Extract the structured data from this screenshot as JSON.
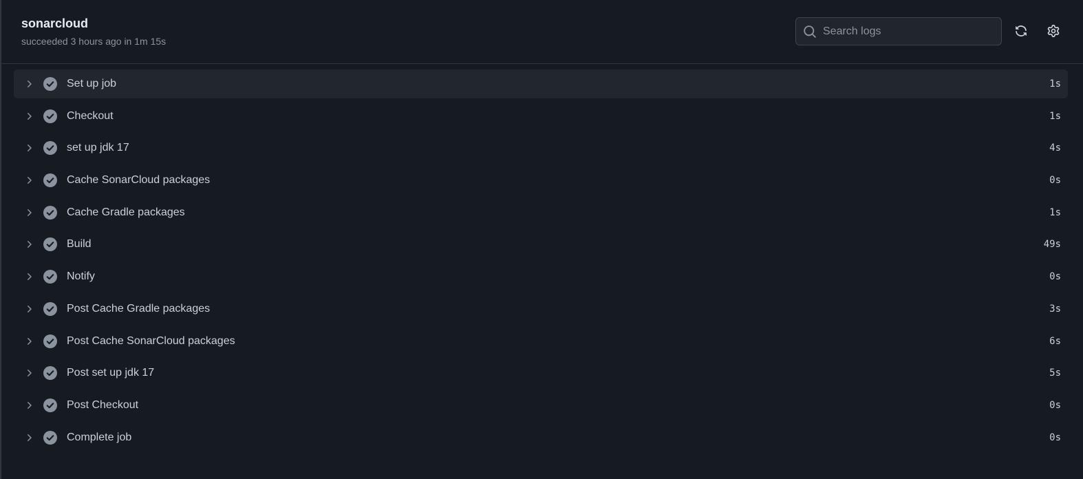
{
  "job": {
    "title": "sonarcloud",
    "subtitle": "succeeded 3 hours ago in 1m 15s"
  },
  "search": {
    "placeholder": "Search logs"
  },
  "toolbar": {
    "refresh_icon": "sync-icon",
    "settings_icon": "gear-icon"
  },
  "colors": {
    "background": "#161b22",
    "hover_row": "#22272e",
    "border": "#30363d",
    "check_fill": "#8b949e"
  },
  "steps": [
    {
      "label": "Set up job",
      "duration": "1s"
    },
    {
      "label": "Checkout",
      "duration": "1s"
    },
    {
      "label": "set up jdk 17",
      "duration": "4s"
    },
    {
      "label": "Cache SonarCloud packages",
      "duration": "0s"
    },
    {
      "label": "Cache Gradle packages",
      "duration": "1s"
    },
    {
      "label": "Build",
      "duration": "49s"
    },
    {
      "label": "Notify",
      "duration": "0s"
    },
    {
      "label": "Post Cache Gradle packages",
      "duration": "3s"
    },
    {
      "label": "Post Cache SonarCloud packages",
      "duration": "6s"
    },
    {
      "label": "Post set up jdk 17",
      "duration": "5s"
    },
    {
      "label": "Post Checkout",
      "duration": "0s"
    },
    {
      "label": "Complete job",
      "duration": "0s"
    }
  ]
}
